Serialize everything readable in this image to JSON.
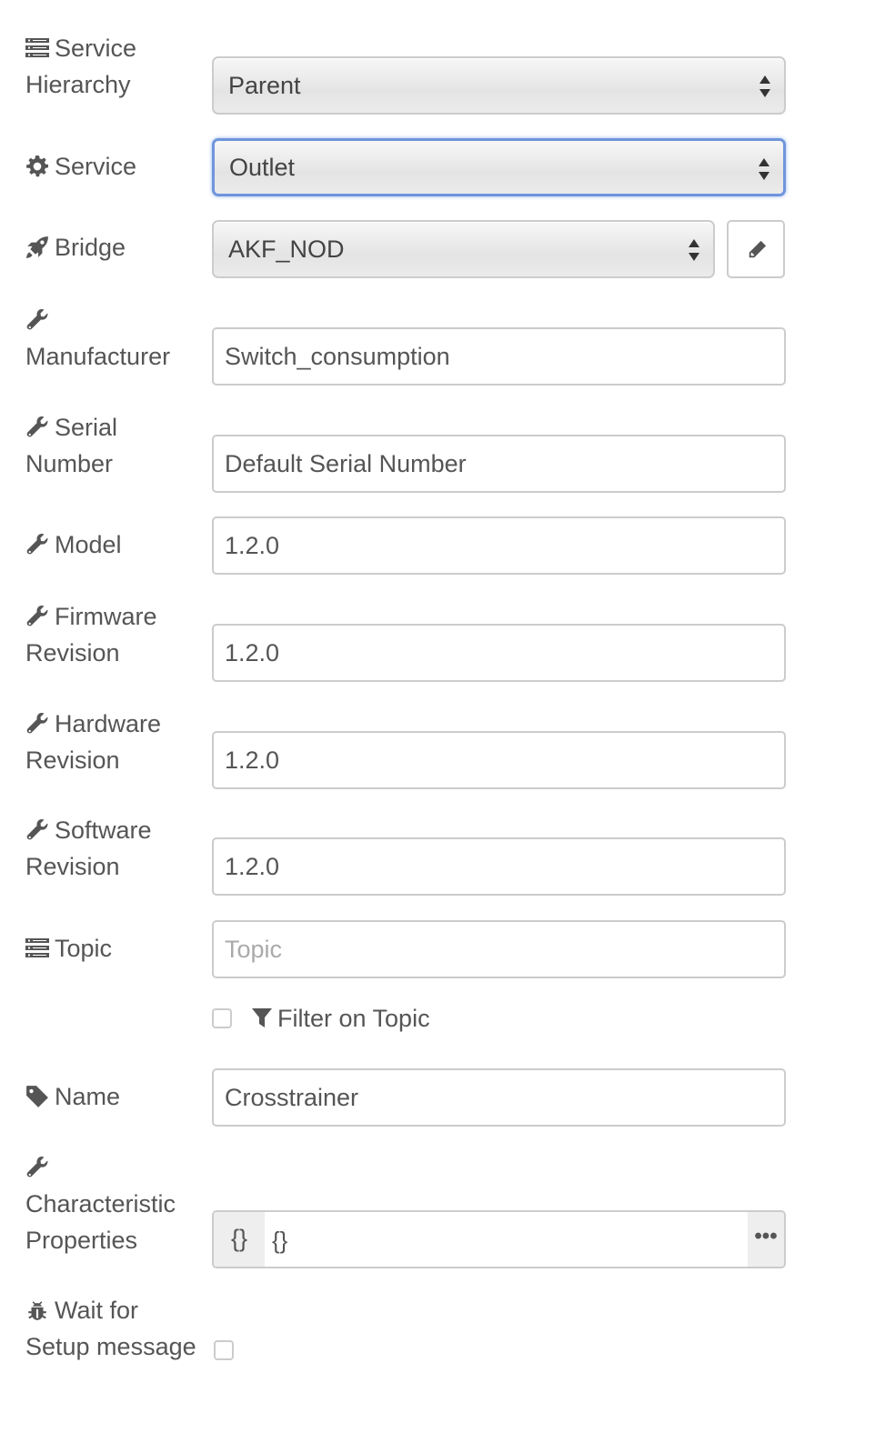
{
  "form": {
    "service_hierarchy": {
      "label_line1": "Service",
      "label_line2": "Hierarchy",
      "value": "Parent",
      "icon": "list-icon"
    },
    "service": {
      "label": "Service",
      "value": "Outlet",
      "icon": "gear-icon"
    },
    "bridge": {
      "label": "Bridge",
      "value": "AKF_NOD",
      "icon": "rocket-icon"
    },
    "manufacturer": {
      "label": "Manufacturer",
      "value": "Switch_consumption",
      "icon": "wrench-icon"
    },
    "serial_number": {
      "label_line1": "Serial",
      "label_line2": "Number",
      "value": "Default Serial Number",
      "icon": "wrench-icon"
    },
    "model": {
      "label": "Model",
      "value": "1.2.0",
      "icon": "wrench-icon"
    },
    "firmware_revision": {
      "label_line1": "Firmware",
      "label_line2": "Revision",
      "value": "1.2.0",
      "icon": "wrench-icon"
    },
    "hardware_revision": {
      "label_line1": "Hardware",
      "label_line2": "Revision",
      "value": "1.2.0",
      "icon": "wrench-icon"
    },
    "software_revision": {
      "label_line1": "Software",
      "label_line2": "Revision",
      "value": "1.2.0",
      "icon": "wrench-icon"
    },
    "topic": {
      "label": "Topic",
      "value": "",
      "placeholder": "Topic",
      "icon": "list-icon"
    },
    "filter_on_topic": {
      "label": "Filter on Topic",
      "checked": false,
      "icon": "filter-icon"
    },
    "name": {
      "label": "Name",
      "value": "Crosstrainer",
      "icon": "tag-icon"
    },
    "characteristic_properties": {
      "label_line1": "Characteristic",
      "label_line2": "Properties",
      "type_glyph": "{}",
      "value": "{}",
      "expand_glyph": "•••",
      "icon": "wrench-icon"
    },
    "wait_for_setup": {
      "label_line1": "Wait for",
      "label_line2": "Setup message",
      "checked": false,
      "icon": "bug-icon"
    }
  },
  "colors": {
    "text": "#555555",
    "border": "#cccccc",
    "focus": "#6f95dc",
    "placeholder": "#aaaaaa"
  }
}
